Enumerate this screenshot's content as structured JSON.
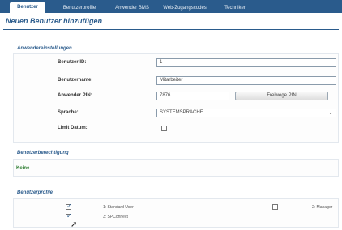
{
  "tabs": [
    {
      "label": "Benutzer",
      "active": true
    },
    {
      "label": "Benutzerprofile",
      "active": false
    },
    {
      "label": "Anwender BMS",
      "active": false
    },
    {
      "label": "Web-Zugangscodes",
      "active": false
    },
    {
      "label": "Techniker",
      "active": false
    }
  ],
  "page_title": "Neuen Benutzer hinzufügen",
  "sections": {
    "settings": "Anwendereinstellungen",
    "authorization": "Benutzerberechtigung",
    "profiles": "Benutzerprofile"
  },
  "form": {
    "user_id_label": "Benutzer ID:",
    "user_id_value": "1",
    "username_label": "Benutzername:",
    "username_value": "Mitarbeiter",
    "pin_label": "Anwender PIN:",
    "pin_value": "7876",
    "pin_button": "Freiwege PIN",
    "language_label": "Sprache:",
    "language_value": "SYSTEMSPRACHE",
    "limit_label": "Limit Datum:",
    "limit_checked": false
  },
  "authorization_value": "Keine",
  "profiles": [
    {
      "label": "1: Standard User",
      "checked": true
    },
    {
      "label": "2: Manager",
      "checked": false
    },
    {
      "label": "3: SPConnect",
      "checked": true
    }
  ],
  "colors": {
    "accent": "#2a5b8c",
    "status_green": "#2e7d32"
  }
}
